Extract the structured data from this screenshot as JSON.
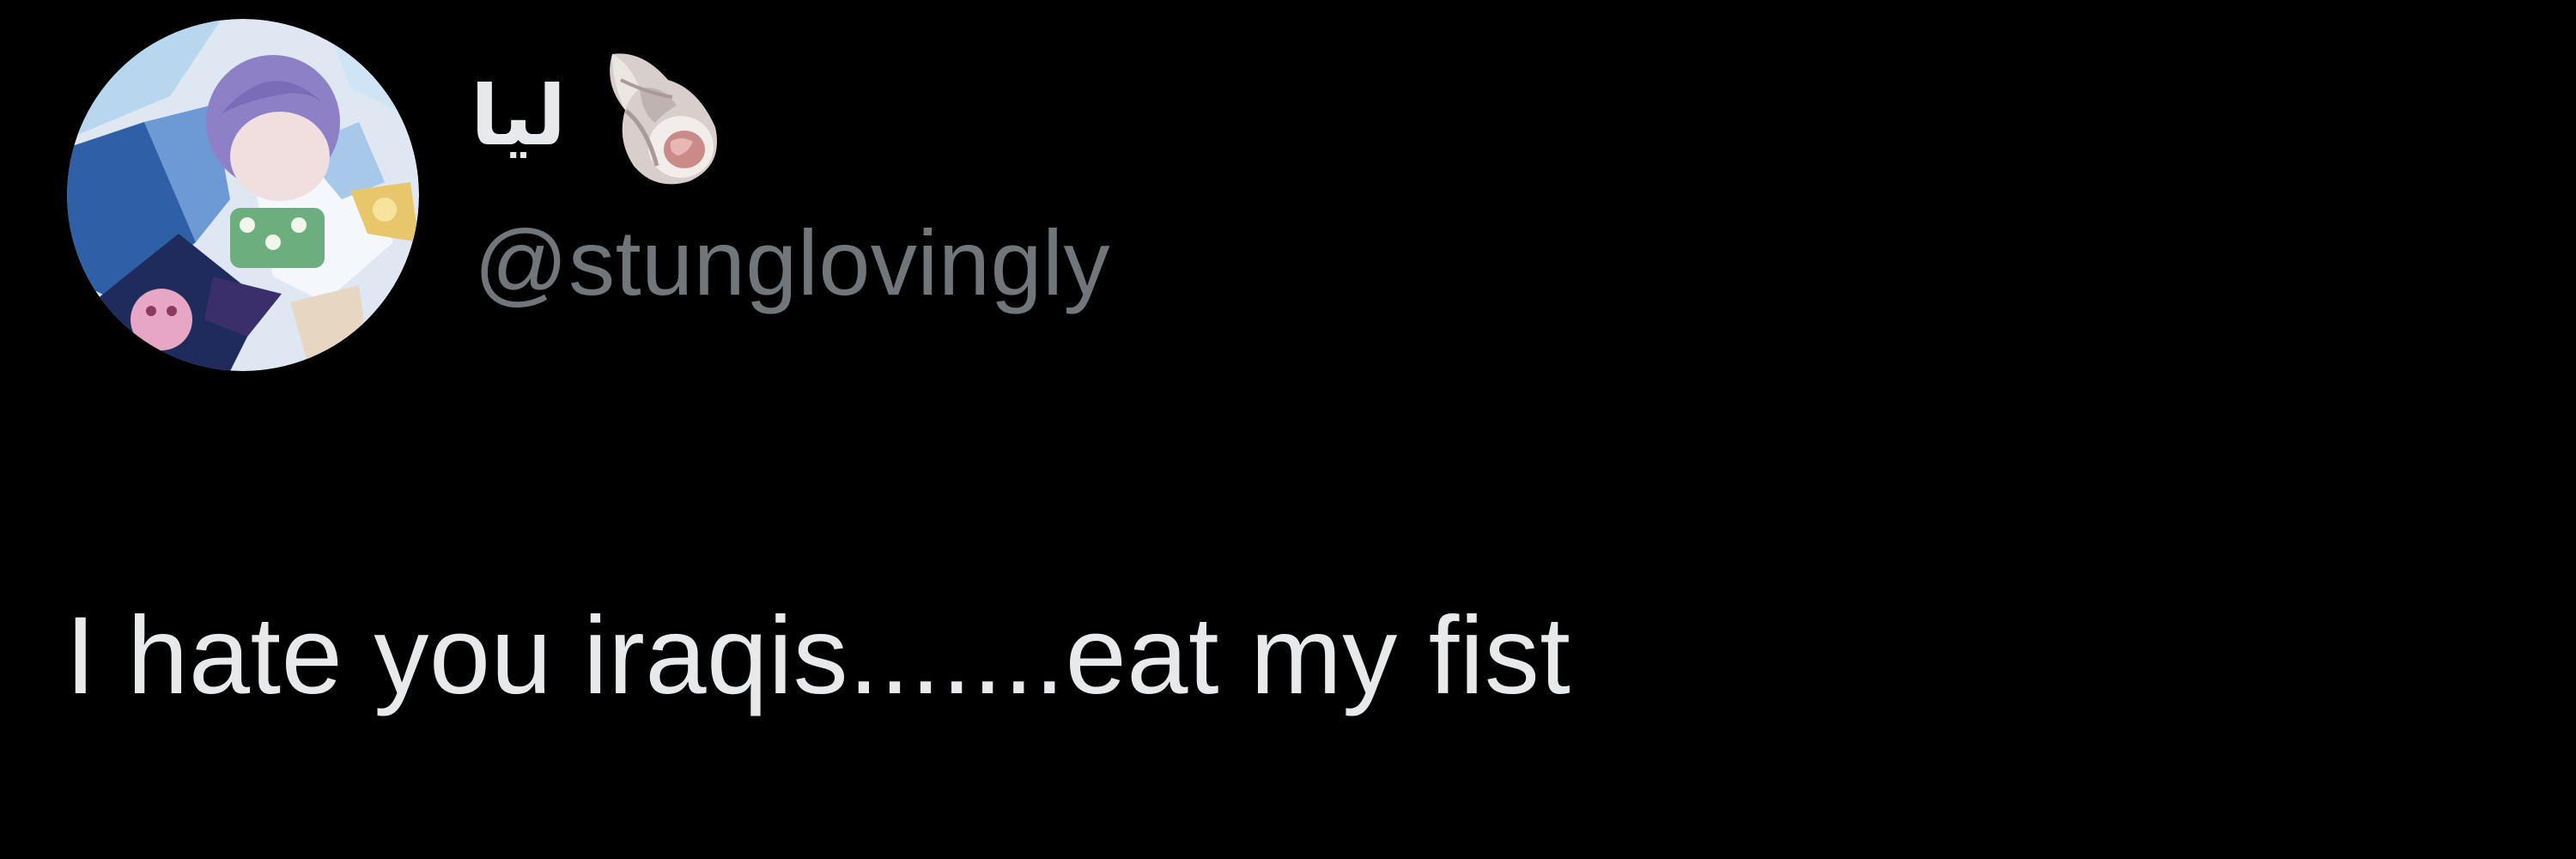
{
  "tweet": {
    "author": {
      "display_name": "ليا",
      "display_name_emoji": "spiral-shell-icon",
      "username": "@stunglovingly",
      "avatar": "profile-avatar-image"
    },
    "text": "I hate you iraqis.......eat my fist"
  },
  "colors": {
    "background": "#000000",
    "primary_text": "#e7e9ea",
    "secondary_text": "#71767b"
  }
}
